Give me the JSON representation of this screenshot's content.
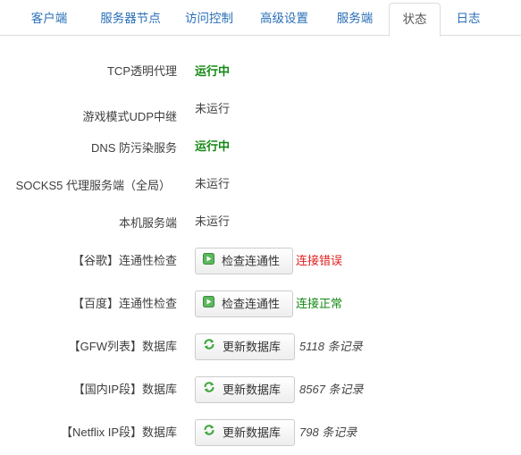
{
  "tabs": [
    "客户端",
    "服务器节点",
    "访问控制",
    "高级设置",
    "服务端",
    "状态",
    "日志"
  ],
  "active_tab": "状态",
  "status_rows": [
    {
      "label": "TCP透明代理",
      "value": "运行中",
      "state": "running"
    },
    {
      "label": "游戏模式UDP中继",
      "value": "未运行",
      "state": "stopped"
    },
    {
      "label": "DNS 防污染服务",
      "value": "运行中",
      "state": "running"
    },
    {
      "label": "SOCKS5 代理服务端（全局）",
      "value": "未运行",
      "state": "stopped"
    },
    {
      "label": "本机服务端",
      "value": "未运行",
      "state": "stopped"
    }
  ],
  "connectivity": [
    {
      "label": "【谷歌】连通性检查",
      "button": "检查连通性",
      "result": "连接错误",
      "result_state": "error"
    },
    {
      "label": "【百度】连通性检查",
      "button": "检查连通性",
      "result": "连接正常",
      "result_state": "ok"
    }
  ],
  "databases": [
    {
      "label": "【GFW列表】数据库",
      "button": "更新数据库",
      "count": "5118 条记录"
    },
    {
      "label": "【国内IP段】数据库",
      "button": "更新数据库",
      "count": "8567 条记录"
    },
    {
      "label": "【Netflix IP段】数据库",
      "button": "更新数据库",
      "count": "798 条记录"
    }
  ],
  "colors": {
    "running": "#138813",
    "error": "#e02020",
    "tab_link": "#2a6fb8"
  },
  "icons": {
    "check": "play-square-icon",
    "update": "refresh-icon"
  }
}
